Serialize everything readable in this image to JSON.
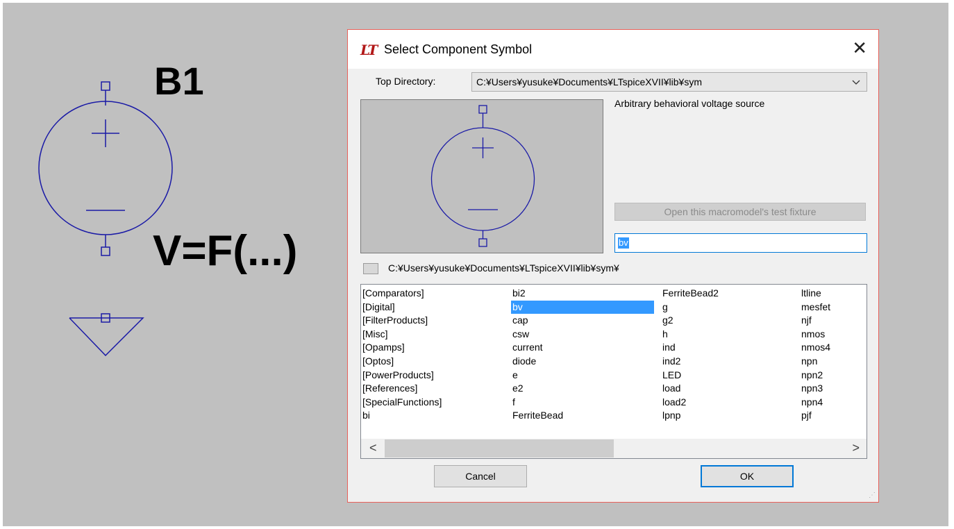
{
  "schematic": {
    "ref": "B1",
    "value": "V=F(...)"
  },
  "dialog": {
    "title": "Select Component Symbol",
    "logo": "LT",
    "close_glyph": "✕",
    "top_dir_label": "Top Directory:",
    "top_dir_value": "C:¥Users¥yusuke¥Documents¥LTspiceXVII¥lib¥sym",
    "description": "Arbitrary behavioral voltage source",
    "open_fixture_label": "Open this macromodel's test fixture",
    "symbol_name": "bv",
    "current_path": "C:¥Users¥yusuke¥Documents¥LTspiceXVII¥lib¥sym¥",
    "selected_item": "bv",
    "list_columns": [
      [
        "[Comparators]",
        "[Digital]",
        "[FilterProducts]",
        "[Misc]",
        "[Opamps]",
        "[Optos]",
        "[PowerProducts]",
        "[References]",
        "[SpecialFunctions]",
        "bi"
      ],
      [
        "bi2",
        "bv",
        "cap",
        "csw",
        "current",
        "diode",
        "e",
        "e2",
        "f",
        "FerriteBead"
      ],
      [
        "FerriteBead2",
        "g",
        "g2",
        "h",
        "ind",
        "ind2",
        "LED",
        "load",
        "load2",
        "lpnp"
      ],
      [
        "ltline",
        "mesfet",
        "njf",
        "nmos",
        "nmos4",
        "npn",
        "npn2",
        "npn3",
        "npn4",
        "pjf"
      ]
    ],
    "scroll_left": "<",
    "scroll_right": ">",
    "cancel_label": "Cancel",
    "ok_label": "OK"
  },
  "colors": {
    "symbol_stroke": "#1a1aa6",
    "selection": "#3399ff",
    "accent": "#0078d7"
  }
}
